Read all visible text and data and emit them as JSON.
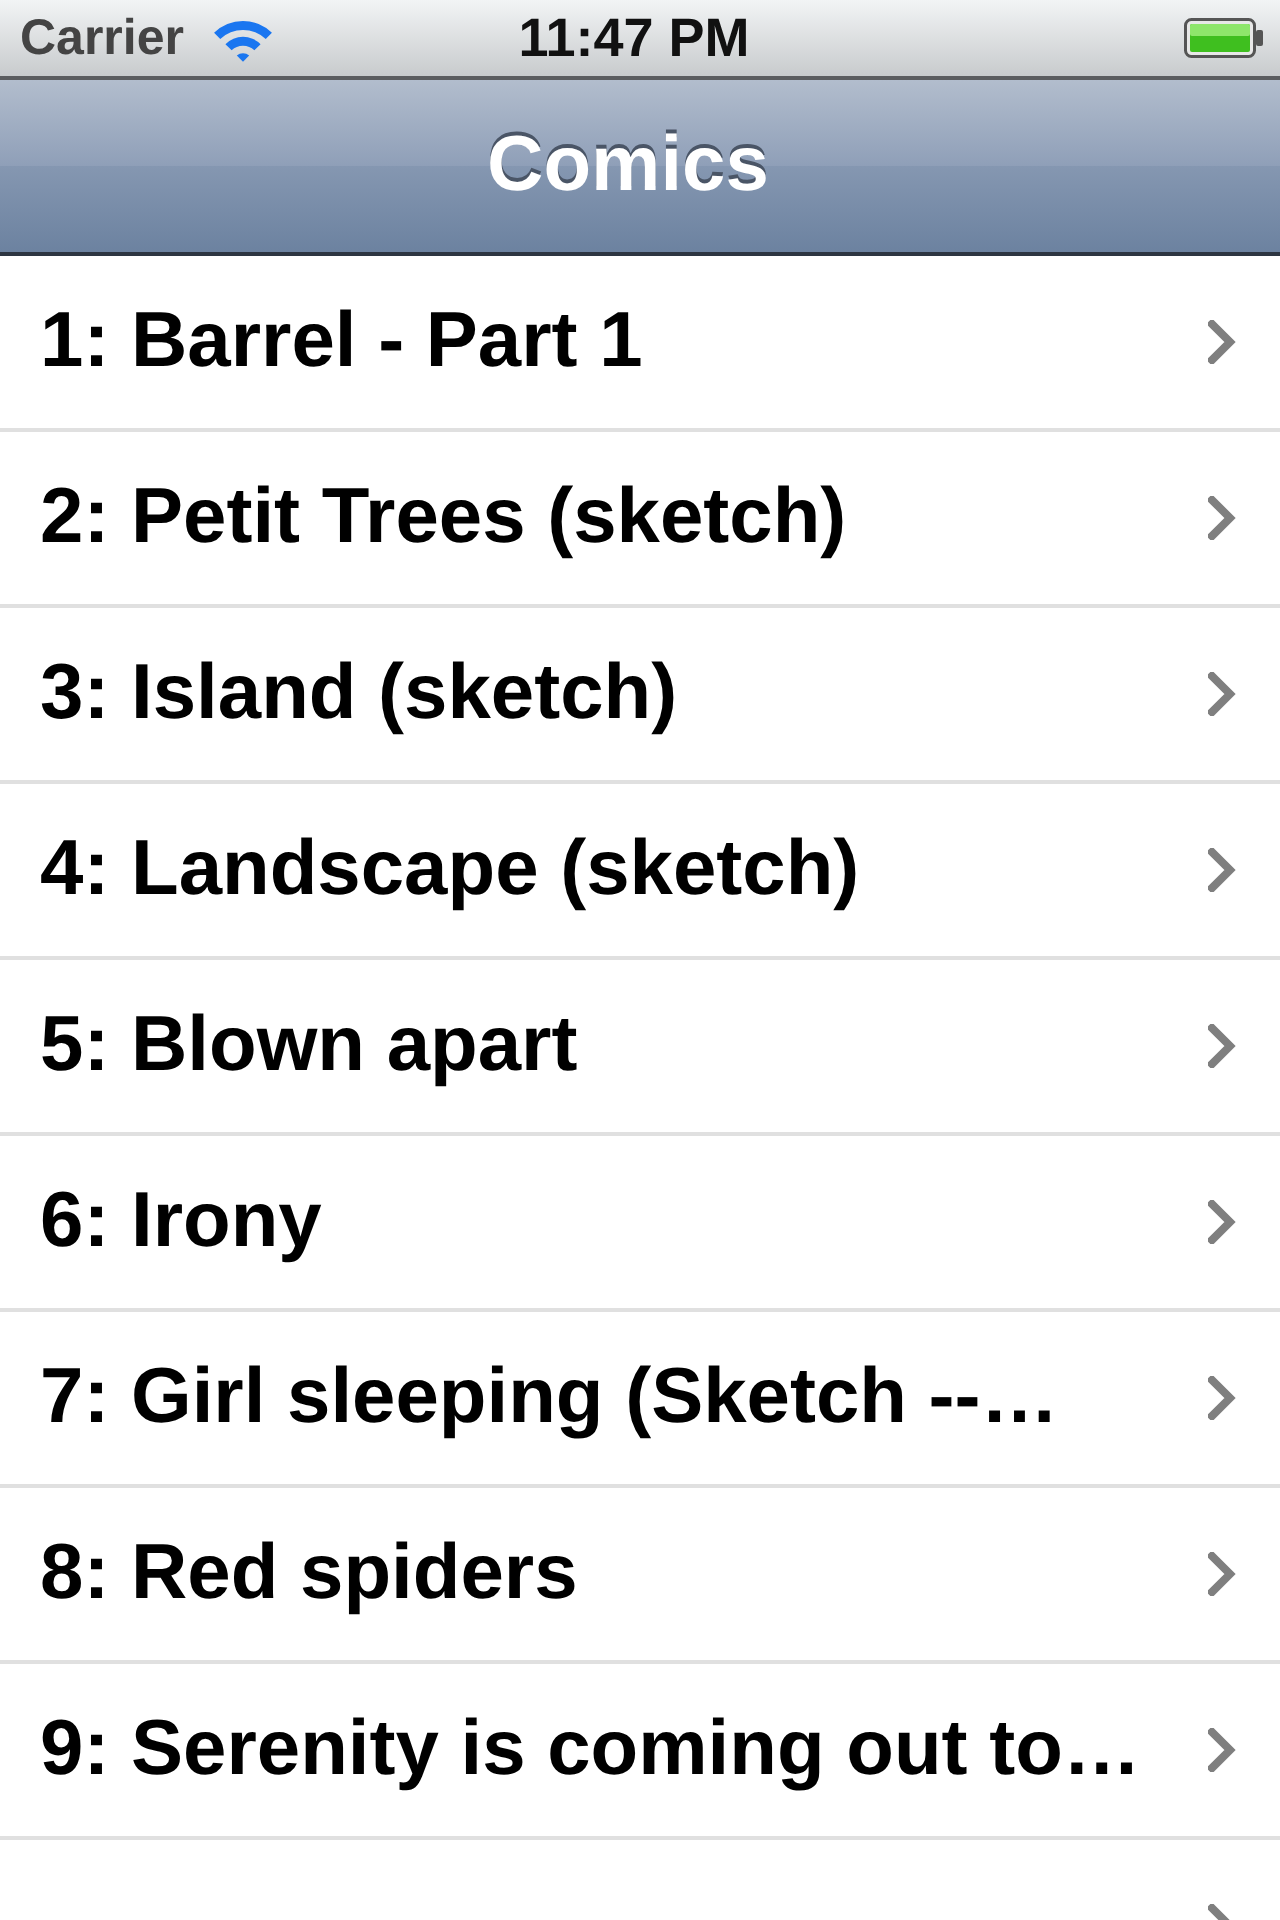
{
  "status_bar": {
    "carrier": "Carrier",
    "time": "11:47 PM"
  },
  "nav_bar": {
    "title": "Comics"
  },
  "comics": [
    {
      "label": "1: Barrel - Part 1"
    },
    {
      "label": "2: Petit Trees (sketch)"
    },
    {
      "label": "3: Island (sketch)"
    },
    {
      "label": "4: Landscape (sketch)"
    },
    {
      "label": "5: Blown apart"
    },
    {
      "label": "6: Irony"
    },
    {
      "label": "7: Girl sleeping (Sketch --…"
    },
    {
      "label": "8: Red spiders"
    },
    {
      "label": "9: Serenity is coming out to…"
    }
  ]
}
